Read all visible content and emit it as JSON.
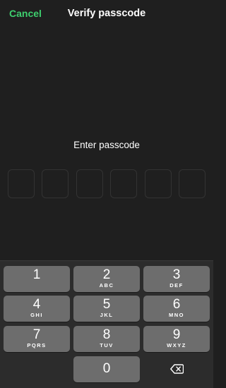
{
  "header": {
    "cancel_label": "Cancel",
    "title": "Verify passcode"
  },
  "prompt": "Enter passcode",
  "passcode": {
    "length": 6,
    "entered_count": 0
  },
  "keypad": {
    "keys": [
      {
        "number": "1",
        "letters": ""
      },
      {
        "number": "2",
        "letters": "ABC"
      },
      {
        "number": "3",
        "letters": "DEF"
      },
      {
        "number": "4",
        "letters": "GHI"
      },
      {
        "number": "5",
        "letters": "JKL"
      },
      {
        "number": "6",
        "letters": "MNO"
      },
      {
        "number": "7",
        "letters": "PQRS"
      },
      {
        "number": "8",
        "letters": "TUV"
      },
      {
        "number": "9",
        "letters": "WXYZ"
      },
      {
        "number": "0",
        "letters": ""
      }
    ],
    "backspace_icon": "backspace-icon"
  },
  "colors": {
    "accent": "#3ecf6e",
    "background": "#1f1f1f",
    "keypad_background": "#2c2c2c",
    "key": "#6d6d6d"
  }
}
